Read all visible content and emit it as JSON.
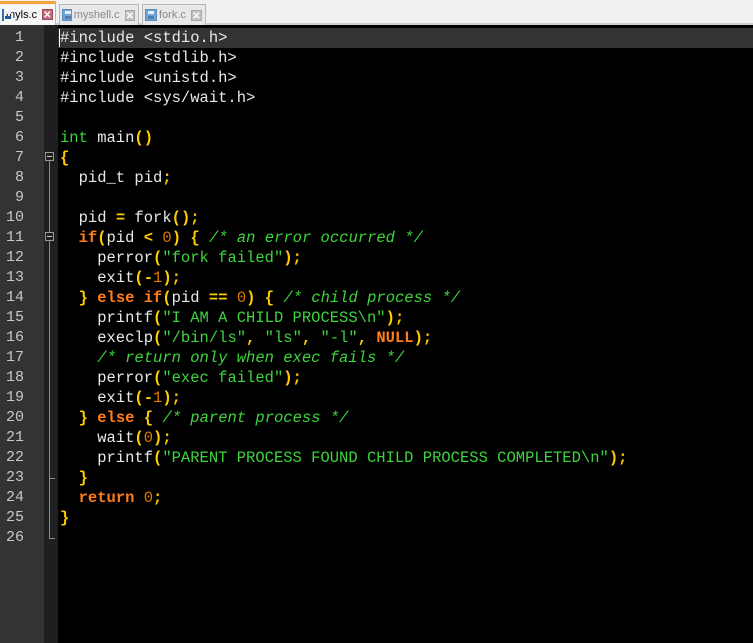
{
  "tabs": [
    {
      "label": "myls.c",
      "active": true,
      "icon": "file-save-icon",
      "close_icon": "close-icon"
    },
    {
      "label": "myshell.c",
      "active": false,
      "icon": "file-save-icon",
      "close_icon": "close-icon"
    },
    {
      "label": "fork.c",
      "active": false,
      "icon": "file-save-icon",
      "close_icon": "close-icon"
    }
  ],
  "colors": {
    "keyword": "#ff7d1a",
    "type": "#3ed43e",
    "operator": "#ffcc00",
    "number": "#e07b00",
    "string": "#3ed43e",
    "comment": "#3ed43e",
    "default": "#e8e8e8",
    "background": "#000000",
    "current_line": "#333333",
    "active_tab_accent": "#f4a23c"
  },
  "editor": {
    "current_line": 1,
    "lines": [
      {
        "n": "1",
        "tokens": [
          [
            "pre",
            "#include <stdio.h>"
          ]
        ]
      },
      {
        "n": "2",
        "tokens": [
          [
            "pre",
            "#include <stdlib.h>"
          ]
        ]
      },
      {
        "n": "3",
        "tokens": [
          [
            "pre",
            "#include <unistd.h>"
          ]
        ]
      },
      {
        "n": "4",
        "tokens": [
          [
            "pre",
            "#include <sys/wait.h>"
          ]
        ]
      },
      {
        "n": "5",
        "tokens": []
      },
      {
        "n": "6",
        "tokens": [
          [
            "type",
            "int"
          ],
          [
            "default",
            " main"
          ],
          [
            "op",
            "()"
          ]
        ]
      },
      {
        "n": "7",
        "tokens": [
          [
            "op",
            "{"
          ]
        ]
      },
      {
        "n": "8",
        "tokens": [
          [
            "default",
            "  pid_t pid"
          ],
          [
            "op",
            ";"
          ]
        ]
      },
      {
        "n": "9",
        "tokens": []
      },
      {
        "n": "10",
        "tokens": [
          [
            "default",
            "  pid "
          ],
          [
            "op",
            "="
          ],
          [
            "default",
            " fork"
          ],
          [
            "op",
            "();"
          ]
        ]
      },
      {
        "n": "11",
        "tokens": [
          [
            "default",
            "  "
          ],
          [
            "kw",
            "if"
          ],
          [
            "op",
            "("
          ],
          [
            "default",
            "pid "
          ],
          [
            "op",
            "<"
          ],
          [
            "default",
            " "
          ],
          [
            "num",
            "0"
          ],
          [
            "op",
            ")"
          ],
          [
            "default",
            " "
          ],
          [
            "op",
            "{"
          ],
          [
            "default",
            " "
          ],
          [
            "com",
            "/* an error occurred */"
          ]
        ]
      },
      {
        "n": "12",
        "tokens": [
          [
            "default",
            "    perror"
          ],
          [
            "op",
            "("
          ],
          [
            "str",
            "\"fork failed\""
          ],
          [
            "op",
            ");"
          ]
        ]
      },
      {
        "n": "13",
        "tokens": [
          [
            "default",
            "    exit"
          ],
          [
            "op",
            "(-"
          ],
          [
            "num",
            "1"
          ],
          [
            "op",
            ");"
          ]
        ]
      },
      {
        "n": "14",
        "tokens": [
          [
            "default",
            "  "
          ],
          [
            "op",
            "}"
          ],
          [
            "default",
            " "
          ],
          [
            "kw",
            "else if"
          ],
          [
            "op",
            "("
          ],
          [
            "default",
            "pid "
          ],
          [
            "op",
            "=="
          ],
          [
            "default",
            " "
          ],
          [
            "num",
            "0"
          ],
          [
            "op",
            ")"
          ],
          [
            "default",
            " "
          ],
          [
            "op",
            "{"
          ],
          [
            "default",
            " "
          ],
          [
            "com",
            "/* child process */"
          ]
        ]
      },
      {
        "n": "15",
        "tokens": [
          [
            "default",
            "    printf"
          ],
          [
            "op",
            "("
          ],
          [
            "str",
            "\"I AM A CHILD PROCESS\\n\""
          ],
          [
            "op",
            ");"
          ]
        ]
      },
      {
        "n": "16",
        "tokens": [
          [
            "default",
            "    execlp"
          ],
          [
            "op",
            "("
          ],
          [
            "str",
            "\"/bin/ls\""
          ],
          [
            "op",
            ","
          ],
          [
            "default",
            " "
          ],
          [
            "str",
            "\"ls\""
          ],
          [
            "op",
            ","
          ],
          [
            "default",
            " "
          ],
          [
            "str",
            "\"-l\""
          ],
          [
            "op",
            ","
          ],
          [
            "default",
            " "
          ],
          [
            "kw",
            "NULL"
          ],
          [
            "op",
            ");"
          ]
        ]
      },
      {
        "n": "17",
        "tokens": [
          [
            "default",
            "    "
          ],
          [
            "com",
            "/* return only when exec fails */"
          ]
        ]
      },
      {
        "n": "18",
        "tokens": [
          [
            "default",
            "    perror"
          ],
          [
            "op",
            "("
          ],
          [
            "str",
            "\"exec failed\""
          ],
          [
            "op",
            ");"
          ]
        ]
      },
      {
        "n": "19",
        "tokens": [
          [
            "default",
            "    exit"
          ],
          [
            "op",
            "(-"
          ],
          [
            "num",
            "1"
          ],
          [
            "op",
            ");"
          ]
        ]
      },
      {
        "n": "20",
        "tokens": [
          [
            "default",
            "  "
          ],
          [
            "op",
            "}"
          ],
          [
            "default",
            " "
          ],
          [
            "kw",
            "else"
          ],
          [
            "default",
            " "
          ],
          [
            "op",
            "{"
          ],
          [
            "default",
            " "
          ],
          [
            "com",
            "/* parent process */"
          ]
        ]
      },
      {
        "n": "21",
        "tokens": [
          [
            "default",
            "    wait"
          ],
          [
            "op",
            "("
          ],
          [
            "num",
            "0"
          ],
          [
            "op",
            ");"
          ]
        ]
      },
      {
        "n": "22",
        "tokens": [
          [
            "default",
            "    printf"
          ],
          [
            "op",
            "("
          ],
          [
            "str",
            "\"PARENT PROCESS FOUND CHILD PROCESS COMPLETED\\n\""
          ],
          [
            "op",
            ");"
          ]
        ]
      },
      {
        "n": "23",
        "tokens": [
          [
            "default",
            "  "
          ],
          [
            "op",
            "}"
          ]
        ]
      },
      {
        "n": "24",
        "tokens": [
          [
            "default",
            "  "
          ],
          [
            "kw",
            "return"
          ],
          [
            "default",
            " "
          ],
          [
            "num",
            "0"
          ],
          [
            "op",
            ";"
          ]
        ]
      },
      {
        "n": "25",
        "tokens": [
          [
            "op",
            "}"
          ]
        ]
      },
      {
        "n": "26",
        "tokens": []
      }
    ]
  }
}
